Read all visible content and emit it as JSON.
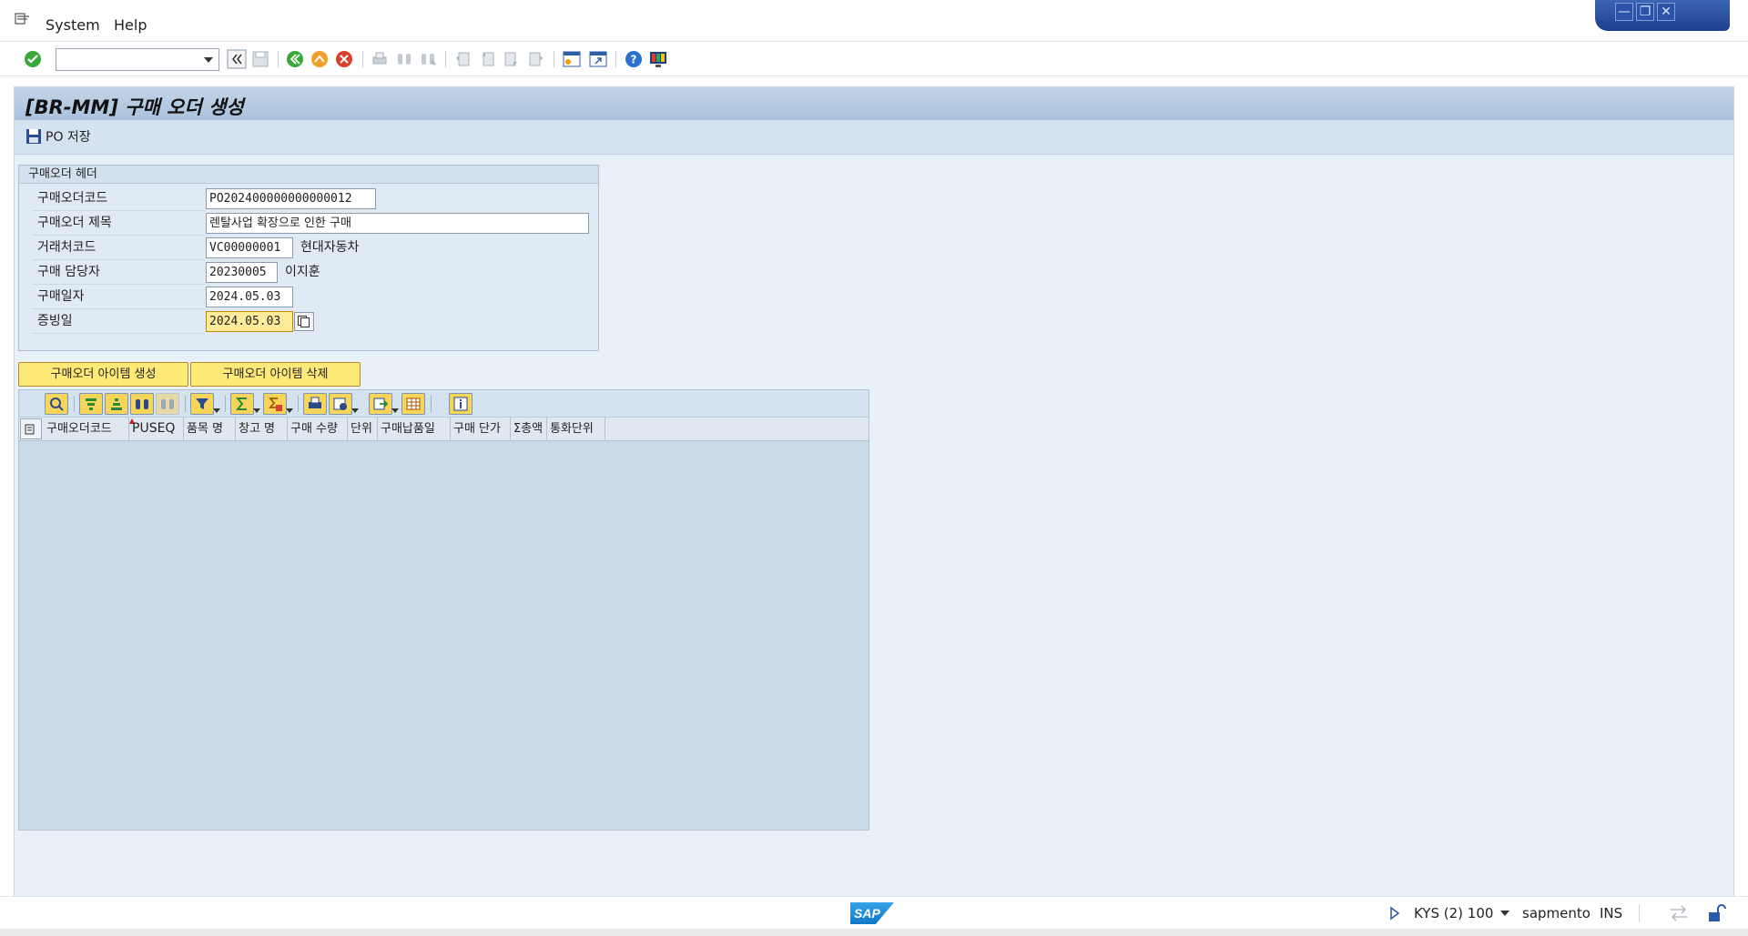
{
  "menu": {
    "system": "System",
    "help": "Help"
  },
  "window_controls": {
    "minimize": "—",
    "restore": "❐",
    "close": "✕"
  },
  "toolbar": {
    "command_field_value": ""
  },
  "screen": {
    "title": "[BR-MM] 구매 오더 생성",
    "save_label": "PO 저장"
  },
  "header_box": {
    "title": "구매오더 헤더",
    "fields": {
      "po_code": {
        "label": "구매오더코드",
        "value": "PO202400000000000012"
      },
      "po_title": {
        "label": "구매오더 제목",
        "value": "렌탈사업 확장으로 인한 구매"
      },
      "vendor": {
        "label": "거래처코드",
        "value": "VC00000001",
        "desc": "현대자동차"
      },
      "buyer": {
        "label": "구매 담당자",
        "value": "20230005",
        "desc": "이지훈"
      },
      "po_date": {
        "label": "구매일자",
        "value": "2024.05.03"
      },
      "doc_date": {
        "label": "증빙일",
        "value": "2024.05.03"
      }
    }
  },
  "buttons": {
    "create_item": "구매오더 아이템 생성",
    "delete_item": "구매오더 아이템 삭제"
  },
  "grid": {
    "columns": [
      "구매오더코드",
      "PUSEQ",
      "품목 명",
      "창고 명",
      "구매 수량",
      "단위",
      "구매납품일",
      "구매 단가",
      "Σ총액",
      "통화단위"
    ]
  },
  "status": {
    "session": "KYS (2) 100",
    "server": "sapmento",
    "mode": "INS",
    "logo": "SAP"
  },
  "colors": {
    "accent_button": "#fde878",
    "title_bar": "#a9c2dd",
    "focus_field": "#ffec9a"
  }
}
